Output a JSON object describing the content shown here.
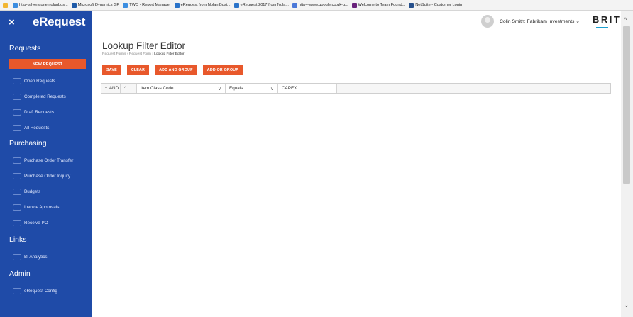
{
  "favorites": [
    {
      "label": "",
      "color": "#f2b632"
    },
    {
      "label": "http--silverstone.nolanbus...",
      "color": "#3b8de0"
    },
    {
      "label": "Microsoft Dynamics GP",
      "color": "#1e5aa8"
    },
    {
      "label": "TWO - Report Manager",
      "color": "#3b8de0"
    },
    {
      "label": "eRequest from Nolan Busi...",
      "color": "#2a73c9"
    },
    {
      "label": "eRequest 2017 from Nola...",
      "color": "#2a73c9"
    },
    {
      "label": "http---www.google.co.uk-u...",
      "color": "#4a78d8"
    },
    {
      "label": "Welcome to Team Found...",
      "color": "#68217a"
    },
    {
      "label": "NetSuite - Customer Login",
      "color": "#26508c"
    }
  ],
  "sidebar": {
    "close_icon": "×",
    "logo": "eRequest",
    "sections": [
      {
        "title": "Requests",
        "button": "NEW REQUEST",
        "items": [
          "Open Requests",
          "Completed Requests",
          "Draft Requests",
          "All Requests"
        ]
      },
      {
        "title": "Purchasing",
        "items": [
          "Purchase Order Transfer",
          "Purchase Order Inquiry",
          "Budgets",
          "Invoice Approvals",
          "Receive PO"
        ]
      },
      {
        "title": "Links",
        "items": [
          "BI Analytics"
        ]
      },
      {
        "title": "Admin",
        "items": [
          "eRequest Config"
        ]
      }
    ]
  },
  "header": {
    "user": "Colin Smith: Fabrikam Investments",
    "user_chevron": "⌄",
    "brand": "BRIT"
  },
  "page": {
    "title": "Lookup Filter Editor",
    "breadcrumb": [
      "Request Forms",
      "Request Form",
      "Lookup Filter Editor"
    ],
    "breadcrumb_sep": "›",
    "actions": [
      "SAVE",
      "CLEAR",
      "ADD AND GROUP",
      "ADD OR GROUP"
    ],
    "filter": {
      "group_caret": "^",
      "group_op": "AND",
      "row_caret": "^",
      "field": "Item Class Code",
      "operator": "Equals",
      "value": "CAPEX"
    }
  },
  "colors": {
    "sidebar_bg": "#1f4ba8",
    "accent": "#e8582b",
    "brand_line": "#1aa0d0"
  },
  "icons": {
    "up": "^",
    "down": "⌄",
    "chevron": "∨"
  }
}
